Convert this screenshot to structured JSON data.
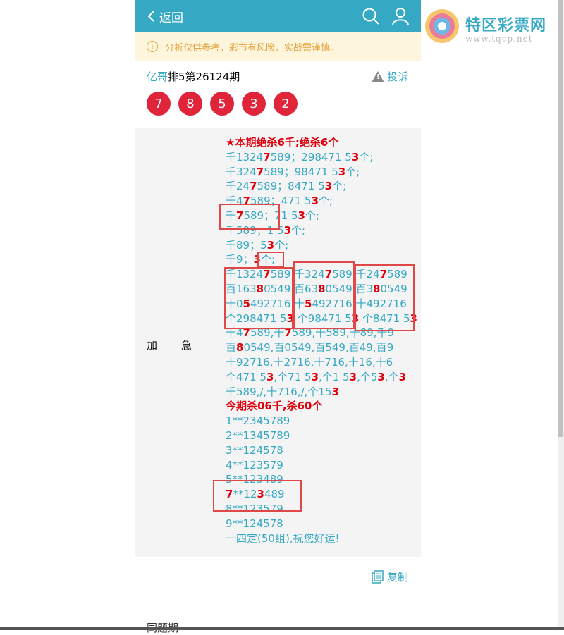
{
  "header": {
    "back_label": "返回"
  },
  "notice": {
    "text": "分析仅供参考，彩市有风险，实战需谨慎。"
  },
  "post": {
    "author": "亿哥",
    "title": "排5第26124期",
    "report_label": "投诉"
  },
  "balls": [
    "7",
    "8",
    "5",
    "3",
    "2"
  ],
  "section_label": "加急",
  "content_lines": [
    [
      {
        "t": "★本期绝杀6千;绝杀6个",
        "c": "h"
      }
    ],
    [
      {
        "t": "千1324"
      },
      {
        "t": "7",
        "c": "r"
      },
      {
        "t": "589；298471 5"
      },
      {
        "t": "3",
        "c": "r"
      },
      {
        "t": "个;"
      }
    ],
    [
      {
        "t": "千324"
      },
      {
        "t": "7",
        "c": "r"
      },
      {
        "t": "589；98471 5"
      },
      {
        "t": "3",
        "c": "r"
      },
      {
        "t": "个;"
      }
    ],
    [
      {
        "t": "千24"
      },
      {
        "t": "7",
        "c": "r"
      },
      {
        "t": "589；8471 5"
      },
      {
        "t": "3",
        "c": "r"
      },
      {
        "t": "个;"
      }
    ],
    [
      {
        "t": "千4"
      },
      {
        "t": "7",
        "c": "r"
      },
      {
        "t": "589；471 5"
      },
      {
        "t": "3",
        "c": "r"
      },
      {
        "t": "个;"
      }
    ],
    [
      {
        "t": "千"
      },
      {
        "t": "7",
        "c": "r"
      },
      {
        "t": "589；71 5"
      },
      {
        "t": "3",
        "c": "r"
      },
      {
        "t": "个;"
      }
    ],
    [
      {
        "t": "千589；1 5"
      },
      {
        "t": "3",
        "c": "r"
      },
      {
        "t": "个;"
      }
    ],
    [
      {
        "t": "千89；5"
      },
      {
        "t": "3",
        "c": "r"
      },
      {
        "t": "个;"
      }
    ],
    [
      {
        "t": "千9；"
      },
      {
        "t": "3",
        "c": "r"
      },
      {
        "t": "个;"
      }
    ],
    [
      {
        "t": "千1324"
      },
      {
        "t": "7",
        "c": "r"
      },
      {
        "t": "589 千324"
      },
      {
        "t": "7",
        "c": "r"
      },
      {
        "t": "589 千24"
      },
      {
        "t": "7",
        "c": "r"
      },
      {
        "t": "589"
      }
    ],
    [
      {
        "t": "百163"
      },
      {
        "t": "8",
        "c": "r"
      },
      {
        "t": "0549 百63"
      },
      {
        "t": "8",
        "c": "r"
      },
      {
        "t": "0549 百3"
      },
      {
        "t": "8",
        "c": "r"
      },
      {
        "t": "0549"
      }
    ],
    [
      {
        "t": "十0"
      },
      {
        "t": "5",
        "c": "r"
      },
      {
        "t": "492716 十"
      },
      {
        "t": "5",
        "c": "r"
      },
      {
        "t": "492716 十492716"
      }
    ],
    [
      {
        "t": "个298471 5"
      },
      {
        "t": "3",
        "c": "r"
      },
      {
        "t": " 个98471 5"
      },
      {
        "t": "3",
        "c": "r"
      },
      {
        "t": " 个8471 5"
      },
      {
        "t": "3",
        "c": "r"
      }
    ],
    [
      {
        "t": "千4"
      },
      {
        "t": "7",
        "c": "r"
      },
      {
        "t": "589,千"
      },
      {
        "t": "7",
        "c": "r"
      },
      {
        "t": "589,千589,千89,千9"
      }
    ],
    [
      {
        "t": "百"
      },
      {
        "t": "8",
        "c": "r"
      },
      {
        "t": "0549,百0549,百549,百49,百9"
      }
    ],
    [
      {
        "t": "十92716,十2716,十716,十16,十6"
      }
    ],
    [
      {
        "t": "个471 5"
      },
      {
        "t": "3",
        "c": "r"
      },
      {
        "t": ",个71 5"
      },
      {
        "t": "3",
        "c": "r"
      },
      {
        "t": ",个1 5"
      },
      {
        "t": "3",
        "c": "r"
      },
      {
        "t": ",个5"
      },
      {
        "t": "3",
        "c": "r"
      },
      {
        "t": ",个"
      },
      {
        "t": "3",
        "c": "r"
      }
    ],
    [
      {
        "t": "千589,/,十716,/,个15"
      },
      {
        "t": "3",
        "c": "r"
      }
    ],
    [
      {
        "t": "今期杀06千,杀60个",
        "c": "h"
      }
    ],
    [
      {
        "t": "1**2345789"
      }
    ],
    [
      {
        "t": "2**1345789"
      }
    ],
    [
      {
        "t": "3**124578"
      }
    ],
    [
      {
        "t": "4**123579"
      }
    ],
    [
      {
        "t": "5**123489"
      }
    ],
    [
      {
        "t": "7",
        "c": "r"
      },
      {
        "t": "**12"
      },
      {
        "t": "3",
        "c": "r"
      },
      {
        "t": "489"
      }
    ],
    [
      {
        "t": "8**123579"
      }
    ],
    [
      {
        "t": "9**124578"
      }
    ],
    [
      {
        "t": "一四定(50组),祝您好运!"
      }
    ]
  ],
  "copy_label": "复制",
  "next_section": "同题期",
  "logo": {
    "name": "特区彩票网",
    "url": "www.tqcp.net"
  },
  "colors": {
    "primary": "#35a8c3",
    "ball": "#e0253a",
    "highlight": "#e0000c",
    "notice_bg": "#fdf6dc",
    "mark_box": "#e04848"
  }
}
